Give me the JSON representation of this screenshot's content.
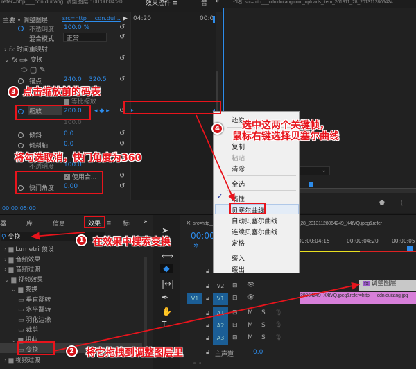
{
  "topbar": {
    "left_title": "refer=http___cdn.duitang. 调整图层 : 00:00:04:20",
    "tab_effect_controls": "效果控件",
    "menu_glyph": "≡",
    "tab_audio": "音",
    "overflow": "»",
    "monitor_title": "作者: src=http___cdn.duitang.com_uploads_item_201311_28_2013112806424"
  },
  "effect_controls": {
    "master": "主要 • 调整图层",
    "clip": "src=http___cdn.dui...",
    "play": "▶",
    "ruler_time_1": ":04:20",
    "ruler_time_2": "00:0",
    "rows": {
      "opacity_label": "不透明度",
      "opacity_value": "100.0 %",
      "blend_label": "混合模式",
      "blend_value": "正常",
      "time_remap": "时间重映射",
      "transform": "变换",
      "anchor_label": "锚点",
      "anchor_x": "240.0",
      "anchor_y": "320.5",
      "uniform_scale": "等比缩放",
      "scale_label": "缩放",
      "scale_value": "200.0",
      "scale_width_value": "100.0",
      "skew_label": "倾斜",
      "skew_value": "0.0",
      "skew_axis_label": "倾斜轴",
      "skew_axis_value": "0.0",
      "opacity2_label": "不透明度",
      "opacity2_value": "100.0",
      "use_comp": "使用合...",
      "shutter_label": "快门角度",
      "shutter_value": "0.00"
    },
    "timecode": "00:00:05:00"
  },
  "context_menu": {
    "items": [
      "还原",
      "复制",
      "粘贴",
      "清除",
      "全选",
      "线性",
      "贝塞尔曲线",
      "自动贝塞尔曲线",
      "连续贝塞尔曲线",
      "定格",
      "缓入",
      "缓出"
    ],
    "checked": "线性",
    "highlighted": "贝塞尔曲线"
  },
  "effects_panel": {
    "tabs": [
      "器",
      "库",
      "信息",
      "效果",
      "标i"
    ],
    "menu_glyph": "≡",
    "overflow": "»",
    "active_tab": "效果",
    "search_value": "变换",
    "tree": [
      "Lumetri 预设",
      "音频效果",
      "音频过渡",
      "视频效果",
      "变换",
      "垂直翻转",
      "水平翻转",
      "羽化边缘",
      "裁剪",
      "扭曲",
      "变换",
      "视频过渡"
    ]
  },
  "timeline": {
    "tab": "src=http___cdn.duitang.com_uploads_item_201311_28_20131128064249_X4tVQ.jpeg&refer",
    "timecode": "00:00:",
    "ruler": [
      "00:00:04:15",
      "00:00:04:20",
      "00:00:05"
    ],
    "tracks": [
      "V2",
      "V1",
      "A1",
      "A2",
      "A3"
    ],
    "source_v1": "V1",
    "mute": "M",
    "solo": "S",
    "master": "主声道",
    "master_value": "0.0",
    "clip_adjustment": "调整图层",
    "clip_fx": "fx",
    "clip_image": "28064249_X4tVQ.jpeg&refer=http___cdn.duitang.jpg"
  },
  "annotations": {
    "step1": {
      "num": "1",
      "text": "在效果中搜索变换"
    },
    "step2": {
      "num": "2",
      "text": "将它拖拽到调整图层里"
    },
    "step3": {
      "num": "3",
      "text": "点击缩放前的码表"
    },
    "step4": {
      "num": "4",
      "line1": "选中这两个关键帧，",
      "line2": "鼠标右键选择贝塞尔曲线"
    },
    "note": "将勾选取消，快门角度为360"
  },
  "colors": {
    "accent": "#2d8ceb",
    "annotation": "#e8141c",
    "clip_pink": "#d77fd9",
    "playhead": "#2d8ceb"
  }
}
